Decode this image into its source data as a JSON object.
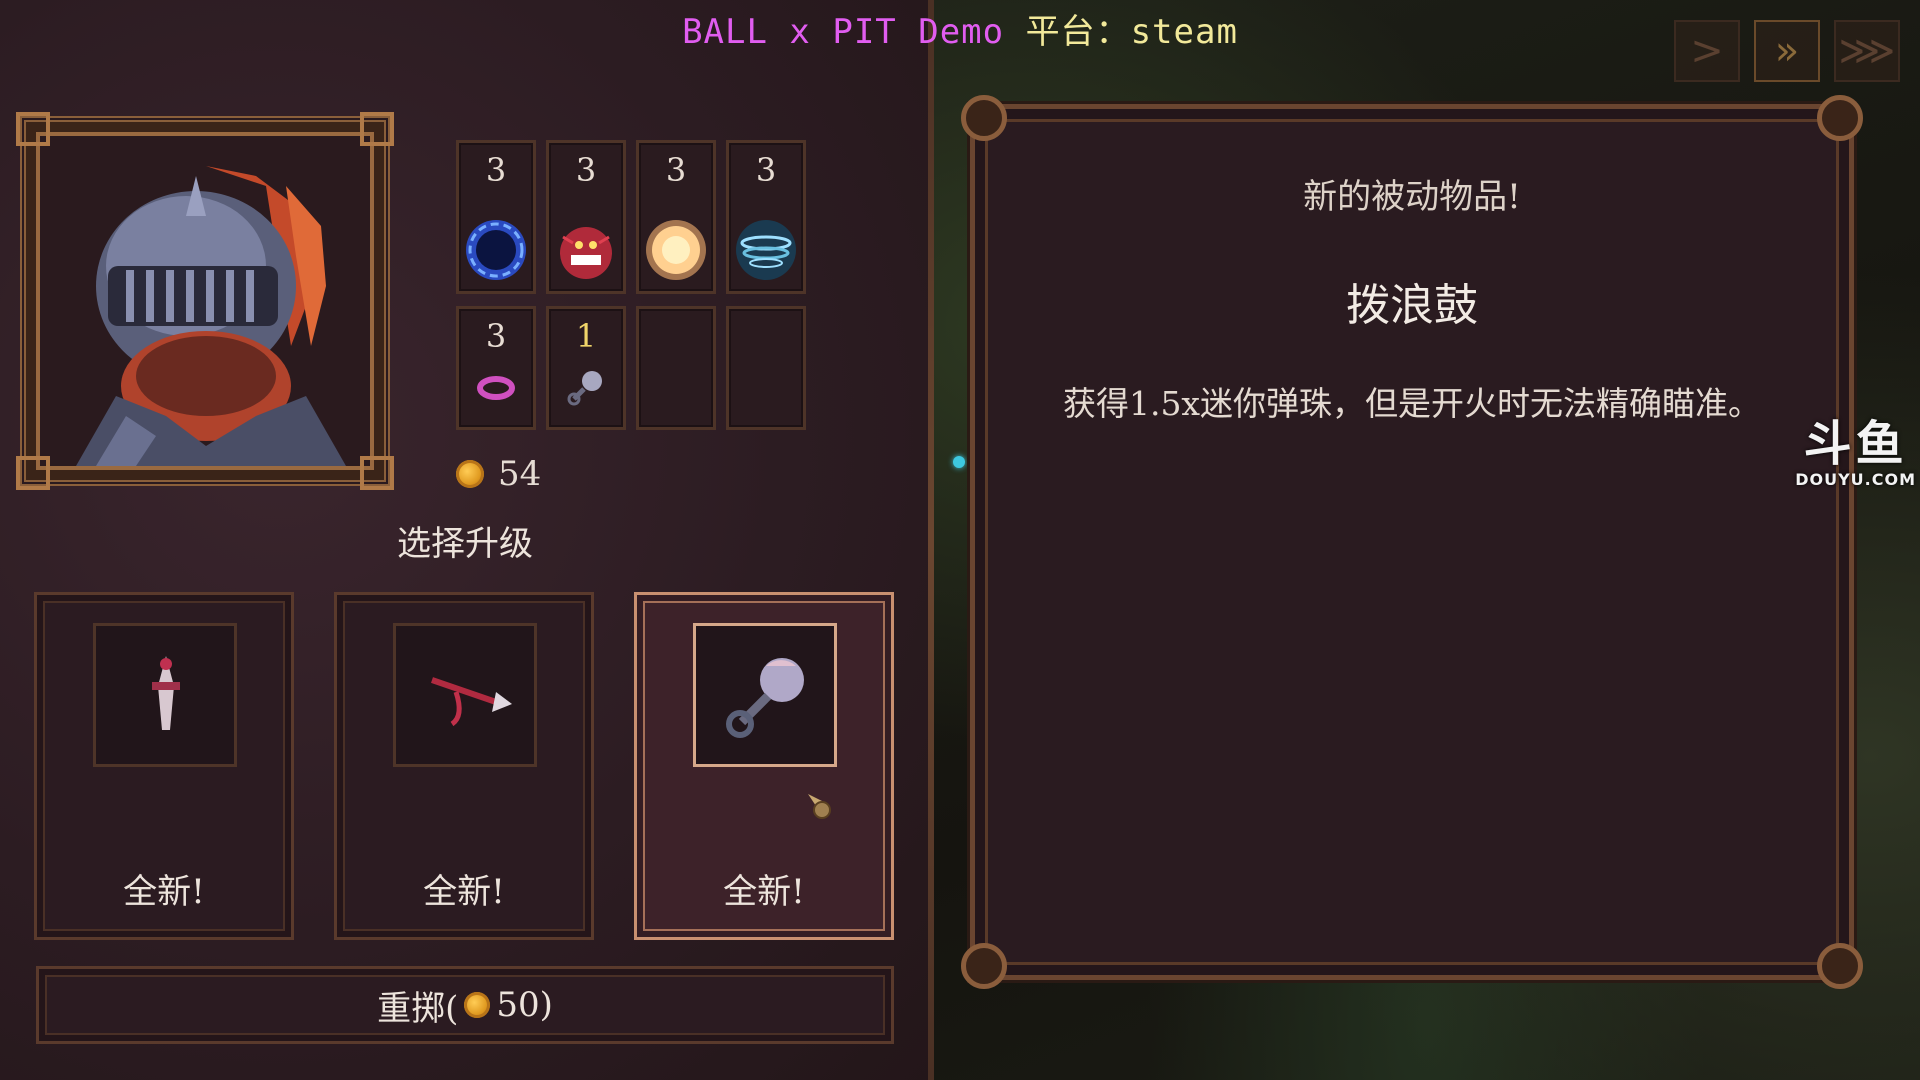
{
  "title": {
    "part1": "BALL x PIT Demo",
    "part2": " 平台：steam"
  },
  "speed_controls": [
    {
      "label": ">",
      "icon": "play-icon"
    },
    {
      "label": "»",
      "icon": "fast-forward-icon"
    },
    {
      "label": "⋙",
      "icon": "fastest-forward-icon"
    }
  ],
  "inventory": {
    "balls": [
      {
        "count": "3",
        "icon": "blue-vortex-ball-icon"
      },
      {
        "count": "3",
        "icon": "red-monster-ball-icon"
      },
      {
        "count": "3",
        "icon": "fire-sun-ball-icon"
      },
      {
        "count": "3",
        "icon": "storm-ball-icon"
      }
    ],
    "passives": [
      {
        "count": "3",
        "icon": "pink-ring-icon"
      },
      {
        "count": "1",
        "icon": "rattle-icon"
      },
      {
        "count": "",
        "icon": "empty-slot"
      },
      {
        "count": "",
        "icon": "empty-slot"
      }
    ]
  },
  "gold": "54",
  "choose_upgrade": "选择升级",
  "cards": [
    {
      "label": "全新!",
      "icon": "dagger-icon"
    },
    {
      "label": "全新!",
      "icon": "arrow-icon"
    },
    {
      "label": "全新!",
      "icon": "rattle-icon"
    }
  ],
  "reroll": {
    "prefix": "重掷(",
    "cost": "50)"
  },
  "info": {
    "header": "新的被动物品!",
    "name": "拨浪鼓",
    "description": "获得1.5x迷你弹珠，但是开火时无法精确瞄准。"
  },
  "watermark": {
    "big": "斗鱼",
    "small": "DOUYU.COM"
  },
  "colors": {
    "title_magenta": "#e15df0",
    "title_yellow": "#f2e99a",
    "gold": "#e09a20",
    "selected_border": "#c99070"
  }
}
